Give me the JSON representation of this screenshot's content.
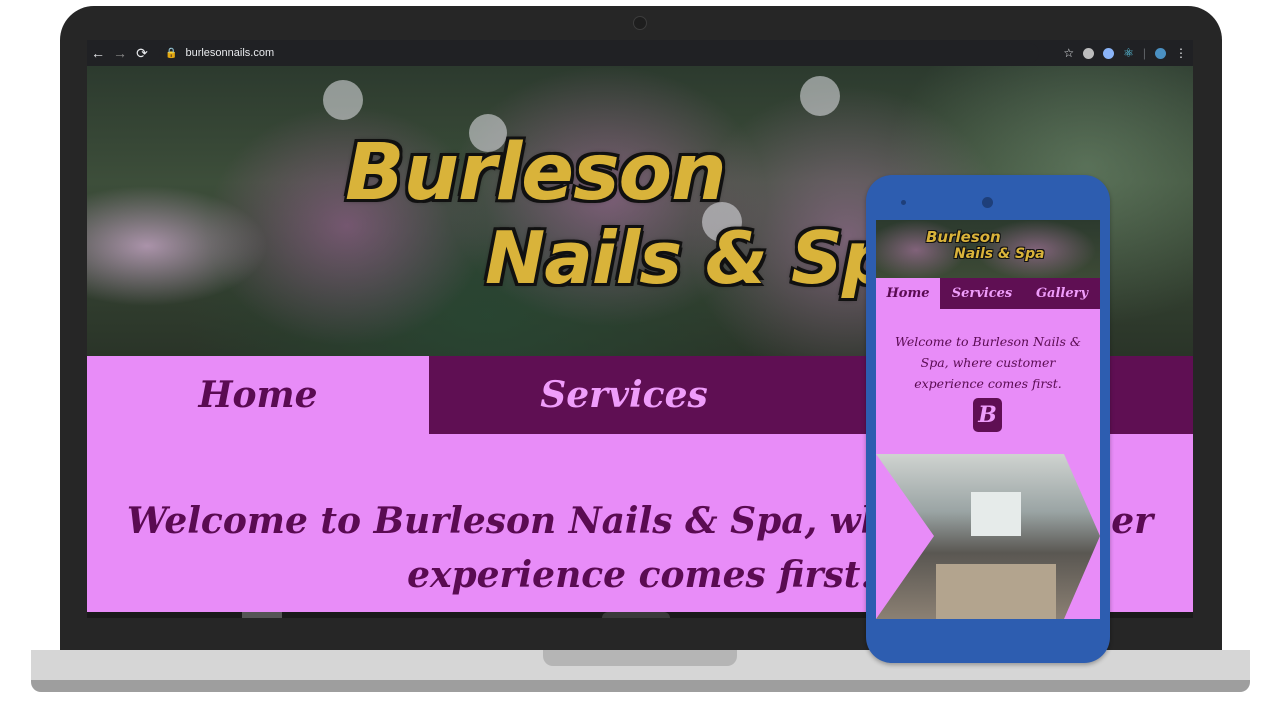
{
  "browser": {
    "url": "burlesonnails.com",
    "back_icon": "arrow-left-icon",
    "forward_icon": "arrow-right-icon",
    "reload_icon": "reload-icon",
    "lock_icon": "lock-icon",
    "bookmark_icon": "star-icon",
    "menu_icon": "kebab-menu-icon"
  },
  "site": {
    "logo_line1": "Burleson",
    "logo_line2": "Nails & Spa",
    "nav": [
      {
        "label": "Home",
        "active": true
      },
      {
        "label": "Services",
        "active": false
      },
      {
        "label": "Gallery",
        "active": false
      }
    ],
    "welcome": "Welcome to Burleson Nails & Spa, where customer experience comes first.",
    "badge_letter": "B"
  },
  "desktop_view": {
    "welcome_line1": "Welcome to Burleson Nails & Spa, where customer",
    "welcome_line2": "experience comes first."
  },
  "colors": {
    "nav_dark": "#5f0f53",
    "nav_light": "#e88cf8",
    "text_dark": "#5a0b52",
    "phone_body": "#2d5db0",
    "logo_gold": "#d9b33a"
  }
}
